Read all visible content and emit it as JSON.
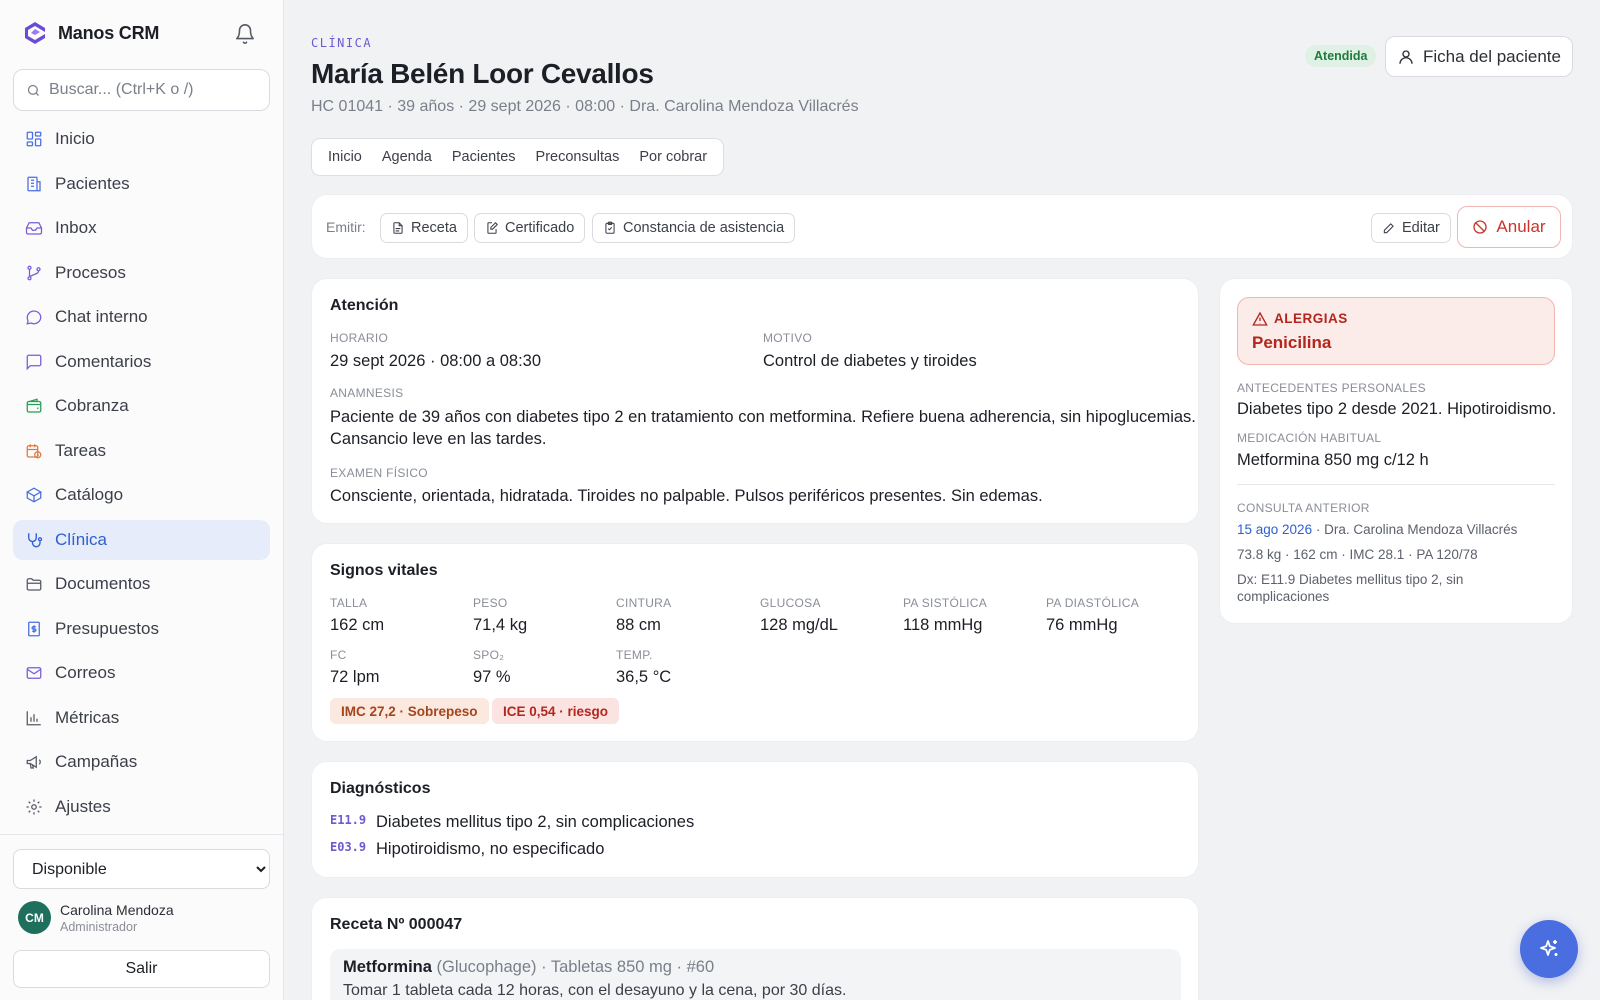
{
  "app": {
    "name": "Manos CRM"
  },
  "search": {
    "placeholder": "Buscar... (Ctrl+K o /)"
  },
  "sidebar": {
    "items": [
      {
        "label": "Inicio",
        "icon": "grid-icon"
      },
      {
        "label": "Pacientes",
        "icon": "building-icon"
      },
      {
        "label": "Inbox",
        "icon": "inbox-icon"
      },
      {
        "label": "Procesos",
        "icon": "branch-icon"
      },
      {
        "label": "Chat interno",
        "icon": "chat-icon"
      },
      {
        "label": "Comentarios",
        "icon": "comment-icon"
      },
      {
        "label": "Cobranza",
        "icon": "wallet-icon"
      },
      {
        "label": "Tareas",
        "icon": "clock-calendar-icon"
      },
      {
        "label": "Catálogo",
        "icon": "box-icon"
      },
      {
        "label": "Clínica",
        "icon": "stethoscope-icon",
        "active": true
      },
      {
        "label": "Documentos",
        "icon": "folder-icon"
      },
      {
        "label": "Presupuestos",
        "icon": "receipt-icon"
      },
      {
        "label": "Correos",
        "icon": "mail-icon"
      },
      {
        "label": "Métricas",
        "icon": "bar-chart-icon"
      },
      {
        "label": "Campañas",
        "icon": "megaphone-icon"
      },
      {
        "label": "Ajustes",
        "icon": "gear-icon"
      }
    ],
    "status": "Disponible",
    "user": {
      "initials": "CM",
      "name": "Carolina Mendoza",
      "role": "Administrador"
    },
    "logout": "Salir"
  },
  "header": {
    "section": "CLÍNICA",
    "patient_name": "María Belén Loor Cevallos",
    "meta": "HC 01041 · 39 años · 29 sept 2026 · 08:00 · Dra. Carolina Mendoza Villacrés",
    "status_badge": "Atendida",
    "ficha_button": "Ficha del paciente"
  },
  "tabs": [
    "Inicio",
    "Agenda",
    "Pacientes",
    "Preconsultas",
    "Por cobrar"
  ],
  "emit": {
    "label": "Emitir:",
    "receta": "Receta",
    "certificado": "Certificado",
    "constancia": "Constancia de asistencia",
    "editar": "Editar",
    "anular": "Anular"
  },
  "atencion": {
    "title": "Atención",
    "horario_label": "HORARIO",
    "horario": "29 sept 2026 · 08:00 a 08:30",
    "motivo_label": "MOTIVO",
    "motivo": "Control de diabetes y tiroides",
    "anamnesis_label": "ANAMNESIS",
    "anamnesis_1": "Paciente de 39 años con diabetes tipo 2 en tratamiento con metformina. Refiere buena adherencia, sin hipoglucemias.",
    "anamnesis_2": "Cansancio leve en las tardes.",
    "examen_label": "EXAMEN FÍSICO",
    "examen": "Consciente, orientada, hidratada. Tiroides no palpable. Pulsos periféricos presentes. Sin edemas."
  },
  "vitales": {
    "title": "Signos vitales",
    "items": [
      {
        "label": "TALLA",
        "value": "162 cm"
      },
      {
        "label": "PESO",
        "value": "71,4 kg"
      },
      {
        "label": "CINTURA",
        "value": "88 cm"
      },
      {
        "label": "GLUCOSA",
        "value": "128 mg/dL"
      },
      {
        "label": "PA SISTÓLICA",
        "value": "118 mmHg"
      },
      {
        "label": "PA DIASTÓLICA",
        "value": "76 mmHg"
      },
      {
        "label": "FC",
        "value": "72 lpm"
      },
      {
        "label": "SPO₂",
        "value": "97 %"
      },
      {
        "label": "TEMP.",
        "value": "36,5 °C"
      }
    ],
    "imc": "IMC 27,2 · Sobrepeso",
    "ice": "ICE 0,54 · riesgo"
  },
  "diagnosticos": {
    "title": "Diagnósticos",
    "items": [
      {
        "code": "E11.9",
        "text": "Diabetes mellitus tipo 2, sin complicaciones"
      },
      {
        "code": "E03.9",
        "text": "Hipotiroidismo, no especificado"
      }
    ]
  },
  "receta": {
    "title": "Receta Nº 000047",
    "drug": "Metformina",
    "detail": "(Glucophage) · Tabletas 850 mg · #60",
    "instructions": "Tomar 1 tableta cada 12 horas, con el desayuno y la cena, por 30 días."
  },
  "side_panel": {
    "allergy_title": "ALERGIAS",
    "allergy": "Penicilina",
    "antecedentes_label": "ANTECEDENTES PERSONALES",
    "antecedentes": "Diabetes tipo 2 desde 2021. Hipotiroidismo.",
    "medicacion_label": "MEDICACIÓN HABITUAL",
    "medicacion": "Metformina 850 mg c/12 h",
    "consulta_label": "CONSULTA ANTERIOR",
    "consulta_date": "15 ago 2026",
    "consulta_doctor": "· Dra. Carolina Mendoza Villacrés",
    "consulta_vitals": "73.8 kg · 162 cm · IMC 28.1 · PA 120/78",
    "consulta_dx_1": "Dx: E11.9 Diabetes mellitus tipo 2, sin",
    "consulta_dx_2": "complicaciones"
  },
  "colors": {
    "accent": "#2f5fd0",
    "danger": "#c9362b",
    "success": "#1f7a3d",
    "code": "#6b5bd2"
  }
}
